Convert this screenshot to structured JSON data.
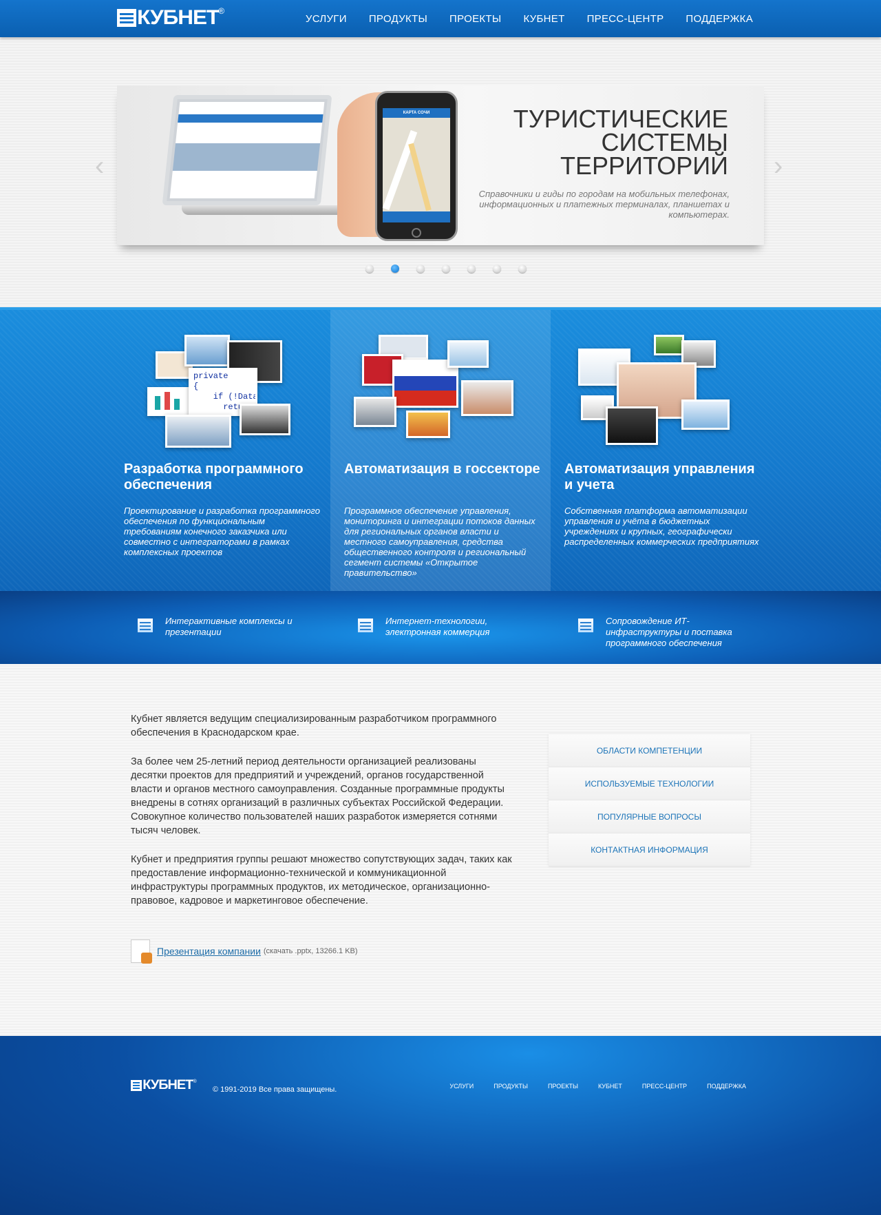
{
  "header": {
    "logo_text": "КУБНЕТ",
    "logo_reg": "®",
    "nav": [
      "УСЛУГИ",
      "ПРОДУКТЫ",
      "ПРОЕКТЫ",
      "КУБНЕТ",
      "ПРЕСС-ЦЕНТР",
      "ПОДДЕРЖКА"
    ]
  },
  "hero": {
    "title_lines": [
      "ТУРИСТИЧЕСКИЕ",
      "СИСТЕМЫ",
      "ТЕРРИТОРИЙ"
    ],
    "description": "Справочники и гиды по городам на мобильных телефонах, информационных и платежных терминалах, планшетах и компьютерах.",
    "phone_header": "КАРТА СОЧИ",
    "prev_arrow": "‹",
    "next_arrow": "›",
    "dots_total": 7,
    "dots_active_index": 1
  },
  "services": [
    {
      "title": "Разработка программного обеспечения",
      "description": "Проектирование и разработка программного обеспечения по функциональным требованиям конечного заказчика или совместно с интеграторами в рамках комплексных проектов",
      "code_sample": "private\n{\n    if (!DataGr\n      return;"
    },
    {
      "title": "Автоматизация в госсекторе",
      "description": "Программное обеспечение управления, мониторинга и интеграции потоков данных для региональных органов власти и местного самоуправления, средства общественного контроля и региональный сегмент системы «Открытое правительство»"
    },
    {
      "title": "Автоматизация управления и учета",
      "description": "Собственная платформа автоматизации управления и учёта в бюджетных учреждениях и крупных, географически распределенных коммерческих предприятиях"
    }
  ],
  "features": [
    "Интерактивные комплексы и презентации",
    "Интернет-технологии, электронная коммерция",
    "Сопровождение ИТ-инфраструктуры и поставка программного обеспечения"
  ],
  "about": {
    "paragraphs": [
      "Кубнет является ведущим специализированным разработчиком программного обеспечения в Краснодарском крае.",
      "За более чем 25-летний период деятельности организацией реализованы десятки проектов для предприятий и учреждений, органов государственной власти и органов местного самоуправления. Созданные программные продукты внедрены в сотнях организаций в различных субъектах Российской Федерации. Совокупное количество пользователей наших разработок измеряется сотнями тысяч человек.",
      "Кубнет и предприятия группы решают множество сопутствующих задач, таких как предоставление информационно-технической и коммуникационной инфраструктуры программных продуктов, их методическое, организационно-правовое, кадровое и маркетинговое обеспечение."
    ],
    "download_link": "Презентация компании",
    "download_meta": "(скачать .pptx, 13266.1 KB)"
  },
  "side_menu": [
    "ОБЛАСТИ КОМПЕТЕНЦИИ",
    "ИСПОЛЬЗУЕМЫЕ ТЕХНОЛОГИИ",
    "ПОПУЛЯРНЫЕ ВОПРОСЫ",
    "КОНТАКТНАЯ ИНФОРМАЦИЯ"
  ],
  "footer": {
    "logo_text": "КУБНЕТ",
    "logo_reg": "®",
    "copyright": "© 1991-2019 Все права защищены.",
    "nav": [
      "УСЛУГИ",
      "ПРОДУКТЫ",
      "ПРОЕКТЫ",
      "КУБНЕТ",
      "ПРЕСС-ЦЕНТР",
      "ПОДДЕРЖКА"
    ]
  },
  "colors": {
    "brand_blue": "#1474cc",
    "link_blue": "#1c74b8",
    "dot_active": "#0a74d1"
  }
}
